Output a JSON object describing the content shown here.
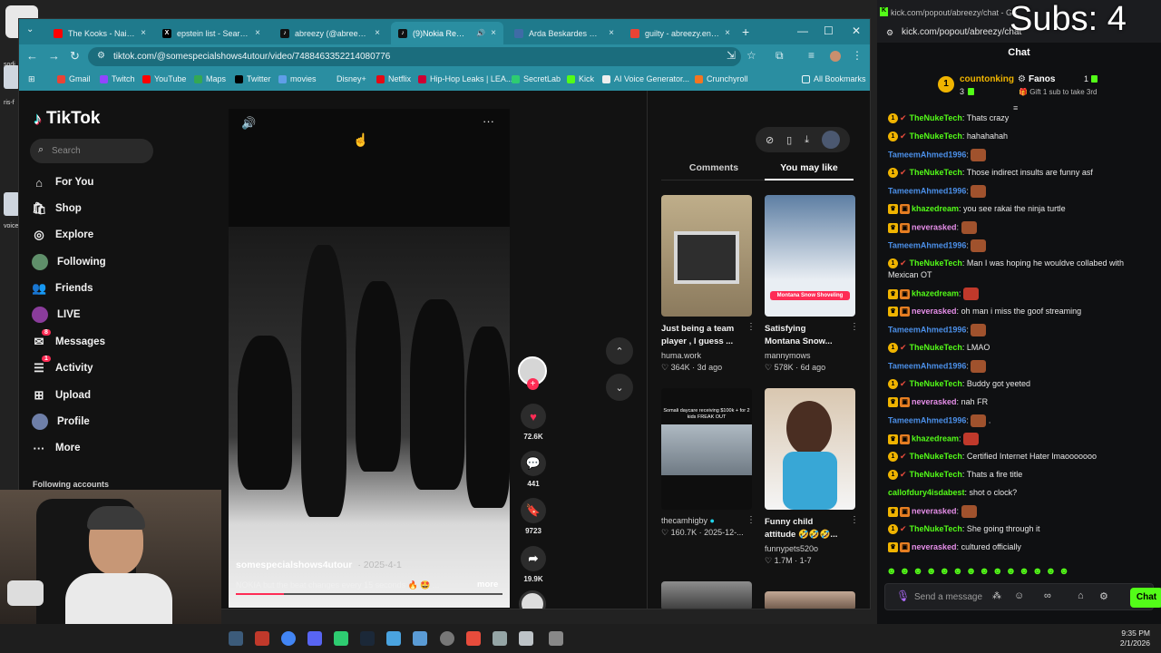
{
  "overlay": {
    "subs_text": "Subs: 4"
  },
  "desktop": {
    "icon_labels": [
      "sodi",
      "ris-f",
      "voice"
    ]
  },
  "browser": {
    "tabs": [
      {
        "title": "The Kooks - Naive - Yo",
        "color": "#ff0000"
      },
      {
        "title": "epstein list - Search / X",
        "color": "#000000"
      },
      {
        "title": "abreezy (@abreezy) | T",
        "color": "#111111"
      },
      {
        "title": "(9)Nokia Remix wit",
        "color": "#111111"
      },
      {
        "title": "Arda Beskardes — JMa",
        "color": "#3f6ba6"
      },
      {
        "title": "guilty - abreezy.ent@g",
        "color": "#ea4335"
      }
    ],
    "address": "tiktok.com/@somespecialshows4utour/video/7488463352214080776",
    "bookmarks": [
      "Gmail",
      "Twitch",
      "YouTube",
      "Maps",
      "Twitter",
      "movies",
      "Disney+",
      "Netflix",
      "Hip-Hop Leaks | LEA...",
      "SecretLab",
      "Kick",
      "AI Voice Generator...",
      "Crunchyroll"
    ],
    "all_bookmarks": "All Bookmarks"
  },
  "tiktok": {
    "logo": "TikTok",
    "search_placeholder": "Search",
    "nav": [
      {
        "label": "For You",
        "icon": "home-icon"
      },
      {
        "label": "Shop",
        "icon": "shop-icon"
      },
      {
        "label": "Explore",
        "icon": "compass-icon"
      },
      {
        "label": "Following",
        "icon": "avatar-icon"
      },
      {
        "label": "Friends",
        "icon": "friends-icon"
      },
      {
        "label": "LIVE",
        "icon": "live-icon"
      },
      {
        "label": "Messages",
        "icon": "messages-icon",
        "badge": "8"
      },
      {
        "label": "Activity",
        "icon": "activity-icon",
        "badge": "1"
      },
      {
        "label": "Upload",
        "icon": "upload-icon"
      },
      {
        "label": "Profile",
        "icon": "profile-icon"
      },
      {
        "label": "More",
        "icon": "more-icon"
      }
    ],
    "following_accounts": "Following accounts",
    "video": {
      "author": "somespecialshows4utour",
      "date": "· 2025-4-1",
      "description": "NOKIA but the beat changes every 15 seconds 🔥 🤩 ...",
      "more": "more",
      "progress": 0.18
    },
    "actions": {
      "likes": "72.6K",
      "comments": "441",
      "saves": "9723",
      "shares": "19.9K"
    },
    "tabs": {
      "comments": "Comments",
      "you_may_like": "You may like"
    },
    "cards": [
      {
        "title": "Just being a team player , I guess ...",
        "author": "huma.work",
        "stats": "♡ 364K · 3d ago"
      },
      {
        "title": "Satisfying Montana Snow...",
        "author": "mannymows",
        "stats": "♡ 578K · 6d ago",
        "overlay": "Montana Snow Shoveling"
      },
      {
        "title": "",
        "author": "thecamhigby",
        "stats": "♡ 160.7K · 2025-12-...",
        "overlay": "Somali daycare receiving $100k + for 2 kids FREAK OUT"
      },
      {
        "title": "Funny child attitude 🤣🤣🤣...",
        "author": "funnypets520o",
        "stats": "♡ 1.7M · 1-7"
      }
    ]
  },
  "kick": {
    "window_title": "kick.com/popout/abreezy/chat - Go",
    "address": "kick.com/popout/abreezy/chat",
    "chat_header": "Chat",
    "pinned": {
      "top_gifter": "countonking",
      "top_count": "3",
      "second": "Fanos",
      "second_count": "1",
      "gift_hint": "Gift 1 sub to take 3rd"
    },
    "messages": [
      {
        "user": "TheNukeTech",
        "text": "Thats crazy",
        "color": "#53fc18",
        "badges": "sub"
      },
      {
        "user": "TheNukeTech",
        "text": "hahahahah",
        "color": "#53fc18",
        "badges": "sub"
      },
      {
        "user": "TameemAhmed1996",
        "text": "",
        "color": "#4b8fe8",
        "emote": true
      },
      {
        "user": "TheNukeTech",
        "text": "Those indirect insults are funny asf",
        "color": "#53fc18",
        "badges": "sub"
      },
      {
        "user": "TameemAhmed1996",
        "text": "",
        "color": "#4b8fe8",
        "emote": true
      },
      {
        "user": "khazedream",
        "text": "you see rakai the ninja turtle",
        "color": "#53fc18",
        "badges": "crown"
      },
      {
        "user": "neverasked",
        "text": "",
        "color": "#e58ee8",
        "badges": "crown",
        "emote": true
      },
      {
        "user": "TameemAhmed1996",
        "text": "",
        "color": "#4b8fe8",
        "emote": true
      },
      {
        "user": "TheNukeTech",
        "text": "Man I was hoping he wouldve collabed with Mexican OT",
        "color": "#53fc18",
        "badges": "sub"
      },
      {
        "user": "khazedream",
        "text": "",
        "color": "#53fc18",
        "badges": "crown",
        "emote": true
      },
      {
        "user": "neverasked",
        "text": "oh man i miss the goof streaming",
        "color": "#e58ee8",
        "badges": "crown"
      },
      {
        "user": "TameemAhmed1996",
        "text": "",
        "color": "#4b8fe8",
        "emote": true
      },
      {
        "user": "TheNukeTech",
        "text": "LMAO",
        "color": "#53fc18",
        "badges": "sub"
      },
      {
        "user": "TameemAhmed1996",
        "text": "",
        "color": "#4b8fe8",
        "emote": true
      },
      {
        "user": "TheNukeTech",
        "text": "Buddy got yeeted",
        "color": "#53fc18",
        "badges": "sub"
      },
      {
        "user": "neverasked",
        "text": "nah FR",
        "color": "#e58ee8",
        "badges": "crown"
      },
      {
        "user": "TameemAhmed1996",
        "text": ".",
        "color": "#4b8fe8",
        "emote": true
      },
      {
        "user": "khazedream",
        "text": "",
        "color": "#53fc18",
        "badges": "crown",
        "emote": true
      },
      {
        "user": "TheNukeTech",
        "text": "Certified Internet Hater lmaooooooo",
        "color": "#53fc18",
        "badges": "sub"
      },
      {
        "user": "TheNukeTech",
        "text": "Thats a fire title",
        "color": "#53fc18",
        "badges": "sub"
      },
      {
        "user": "callofdury4isdabest",
        "text": "shot o clock?",
        "color": "#53fc18"
      },
      {
        "user": "neverasked",
        "text": "",
        "color": "#e58ee8",
        "badges": "crown",
        "emote": true
      },
      {
        "user": "TheNukeTech",
        "text": "She going through it",
        "color": "#53fc18",
        "badges": "sub"
      },
      {
        "user": "neverasked",
        "text": "cultured officially",
        "color": "#e58ee8",
        "badges": "crown"
      }
    ],
    "send_placeholder": "Send a message",
    "chat_button": "Chat"
  },
  "taskbar": {
    "time": "9:35 PM",
    "date": "2/1/2026"
  }
}
